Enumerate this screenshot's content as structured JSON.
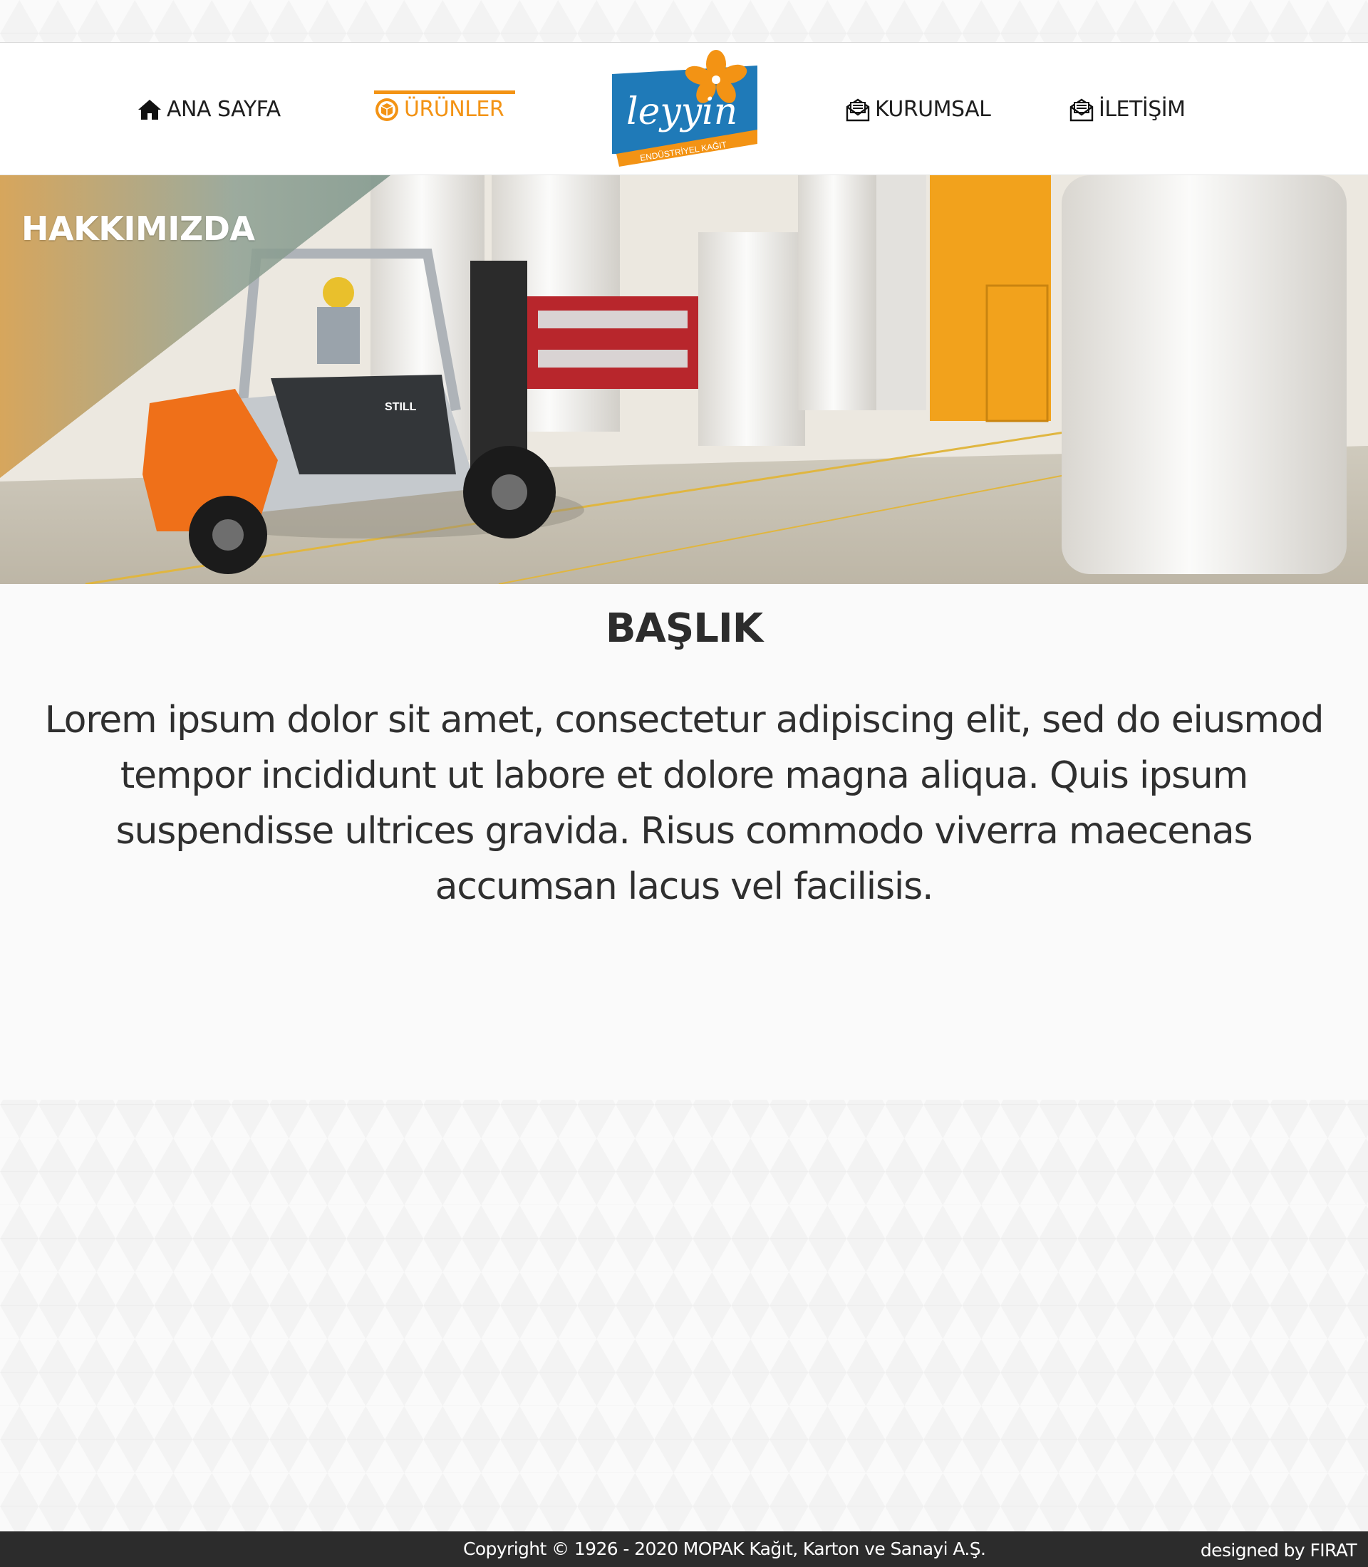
{
  "header": {
    "logo": {
      "text": "leyyin",
      "tagline": "ENDÜSTRİYEL KAĞIT"
    },
    "nav": [
      {
        "label": "ANA SAYFA",
        "icon": "home-icon"
      },
      {
        "label": "ÜRÜNLER",
        "icon": "box-icon",
        "active": true
      },
      {
        "label": "KURUMSAL",
        "icon": "mail-open-icon"
      },
      {
        "label": "İLETİŞİM",
        "icon": "mail-open-icon"
      }
    ]
  },
  "hero": {
    "title": "HAKKIMIZDA",
    "forklift_brand": "STILL"
  },
  "content": {
    "heading": "BAŞLIK",
    "body": "Lorem ipsum dolor sit amet, consectetur adipiscing elit, sed do eiusmod tempor incididunt ut labore et dolore magna aliqua. Quis ipsum suspendisse ultrices gravida. Risus commodo viverra maecenas accumsan lacus vel facilisis."
  },
  "footer": {
    "copyright": "Copyright © 1926 - 2020 MOPAK Kağıt, Karton ve Sanayi A.Ş.",
    "designer": "designed by FIRAT"
  },
  "colors": {
    "accent": "#f39314",
    "logo_blue": "#1f7ab8",
    "footer_bg": "#2c2c2c"
  }
}
